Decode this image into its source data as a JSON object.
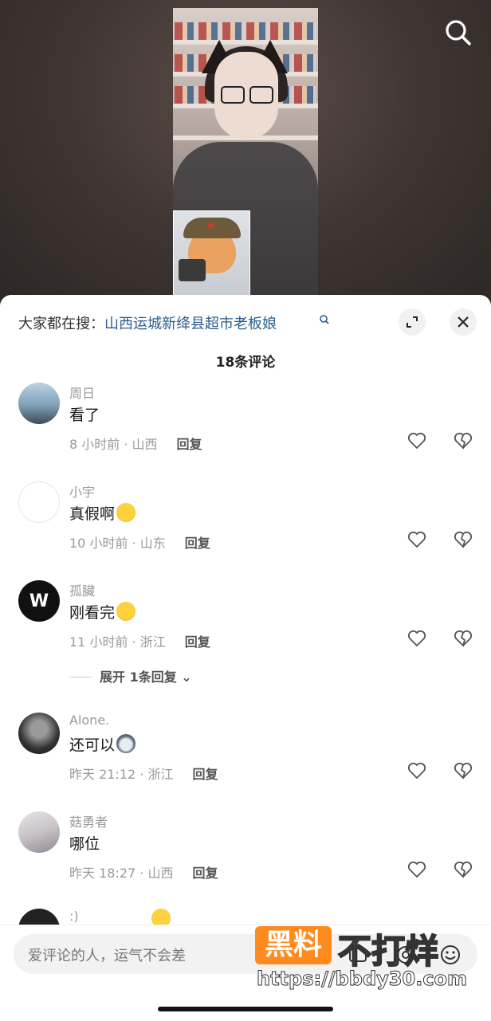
{
  "trending": {
    "prefix": "大家都在搜：",
    "query": "山西运城新绛县超市老板娘"
  },
  "comment_count": "18条评论",
  "comments": [
    {
      "name": "周日",
      "text": "看了",
      "time_location": "8 小时前 · 山西",
      "reply": "回复",
      "avatar_color": "#7fa0b7"
    },
    {
      "name": "小宇",
      "text": "真假啊",
      "emoji": "crying-laughing",
      "time_location": "10 小时前 · 山东",
      "reply": "回复",
      "avatar_color": "#ffffff"
    },
    {
      "name": "孤臟",
      "text": "刚看完",
      "emoji": "crying-laughing",
      "time_location": "11 小时前 · 浙江",
      "reply": "回复",
      "avatar_color": "#111111",
      "expand": "展开 1条回复"
    },
    {
      "name": "Alone.",
      "text": "还可以",
      "emoji": "husky",
      "time_location": "昨天 21:12 · 浙江",
      "reply": "回复",
      "avatar_color": "#333333"
    },
    {
      "name": "菇勇者",
      "text": "哪位",
      "time_location": "昨天 18:27 · 山西",
      "reply": "回复",
      "avatar_color": "#c9c3c8"
    },
    {
      "name": ":)",
      "emoji": "sleepy",
      "avatar_color": "#222222"
    }
  ],
  "input": {
    "placeholder": "爱评论的人，运气不会差"
  },
  "watermark": {
    "box": "黑料",
    "text": "不打烊",
    "url": "https://bbdy30.com"
  },
  "icons": {
    "search": "search-icon",
    "expand": "expand-icon",
    "close": "close-icon",
    "like": "heart-icon",
    "dislike": "broken-heart-icon"
  },
  "colors": {
    "link": "#2a5c8c",
    "watermark_accent": "#ff8a1e"
  }
}
